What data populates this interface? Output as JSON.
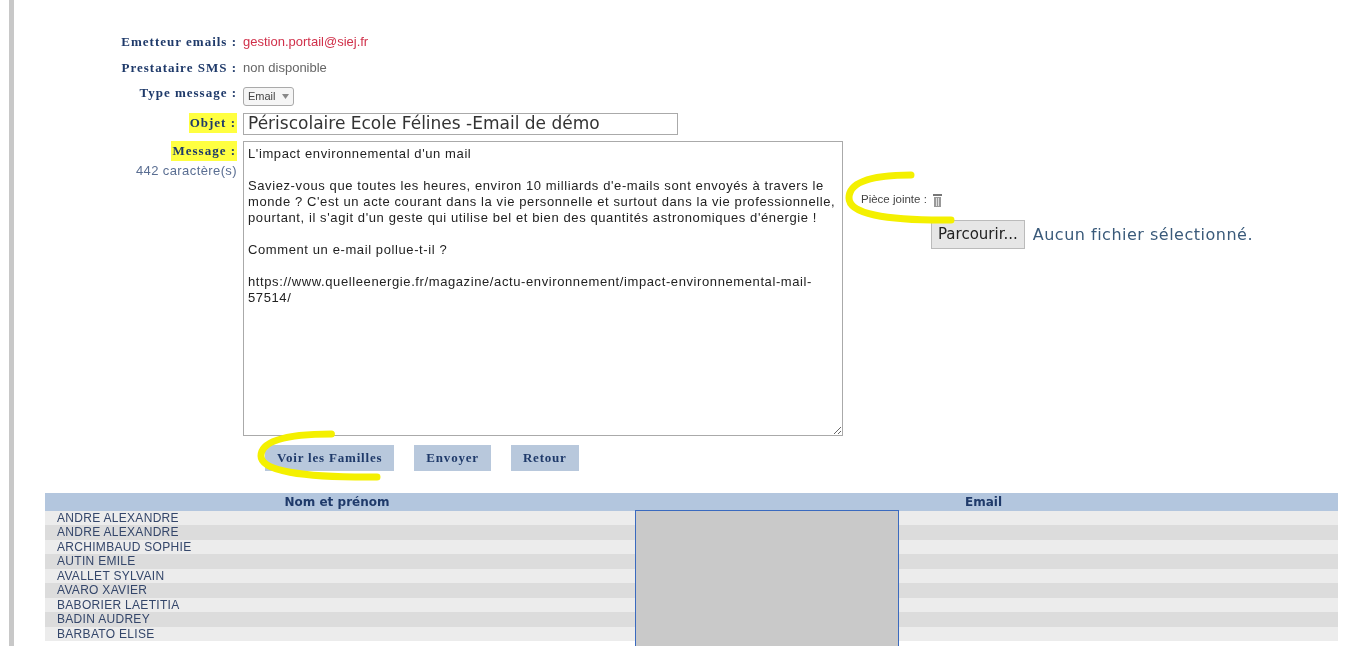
{
  "form": {
    "sender": {
      "label": "Emetteur emails :",
      "value": "gestion.portail@siej.fr"
    },
    "sms": {
      "label": "Prestataire SMS :",
      "value": "non disponible"
    },
    "type": {
      "label": "Type message :",
      "value": "Email"
    },
    "subject": {
      "label": "Objet :",
      "highlighted": true,
      "value": "Périscolaire Ecole Félines -Email de démo"
    },
    "message": {
      "label": "Message :",
      "highlighted": true,
      "count": "442 caractère(s)",
      "value": "L'impact environnemental d'un mail\n\nSaviez-vous que toutes les heures, environ 10 milliards d'e-mails sont envoyés à travers le monde ? C'est un acte courant dans la vie personnelle et surtout dans la vie professionnelle, pourtant, il s'agit d'un geste qui utilise bel et bien des quantités astronomiques d'énergie !\n\nComment un e-mail pollue-t-il ?\n\nhttps://www.quelleenergie.fr/magazine/actu-environnement/impact-environnemental-mail-57514/"
    },
    "attachment": {
      "label": "Pièce jointe :",
      "circled": true,
      "browse": "Parcourir...",
      "status": "Aucun fichier sélectionné."
    }
  },
  "buttons": [
    {
      "label": "Voir les Familles",
      "circled": true
    },
    {
      "label": "Envoyer",
      "circled": false
    },
    {
      "label": "Retour",
      "circled": false
    }
  ],
  "table": {
    "columns": [
      "Nom et prénom",
      "Email"
    ],
    "redacted": true,
    "rows": [
      {
        "name": "ANDRE ALEXANDRE"
      },
      {
        "name": "ANDRE ALEXANDRE"
      },
      {
        "name": "ARCHIMBAUD SOPHIE"
      },
      {
        "name": "AUTIN EMILE"
      },
      {
        "name": "AVALLET SYLVAIN"
      },
      {
        "name": "AVARO XAVIER"
      },
      {
        "name": "BABORIER LAETITIA"
      },
      {
        "name": "BADIN AUDREY"
      },
      {
        "name": "BARBATO ELISE"
      }
    ]
  }
}
